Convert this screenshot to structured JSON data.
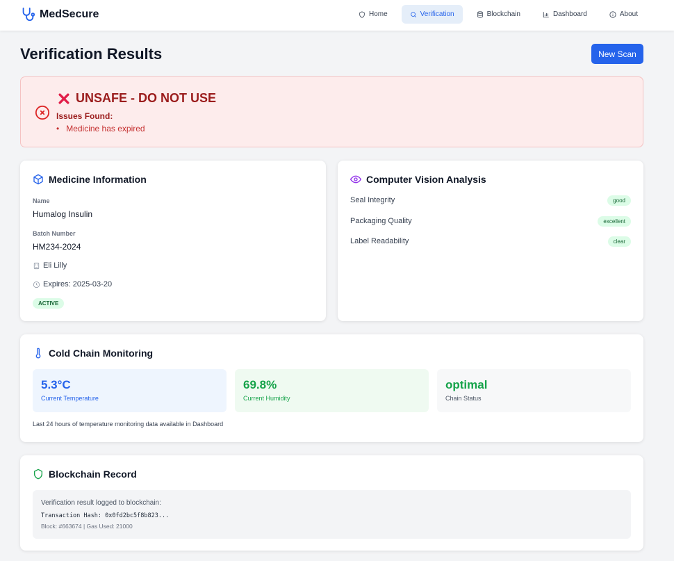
{
  "app": {
    "name": "MedSecure"
  },
  "nav": {
    "items": [
      {
        "label": "Home",
        "icon": "shield-icon",
        "active": false
      },
      {
        "label": "Verification",
        "icon": "search-icon",
        "active": true
      },
      {
        "label": "Blockchain",
        "icon": "database-icon",
        "active": false
      },
      {
        "label": "Dashboard",
        "icon": "bar-chart-icon",
        "active": false
      },
      {
        "label": "About",
        "icon": "info-icon",
        "active": false
      }
    ]
  },
  "page": {
    "title": "Verification Results",
    "new_scan_label": "New Scan"
  },
  "alert": {
    "title": "UNSAFE - DO NOT USE",
    "issues_label": "Issues Found:",
    "issues": [
      "Medicine has expired"
    ]
  },
  "medicine": {
    "title": "Medicine Information",
    "name_label": "Name",
    "name": "Humalog Insulin",
    "batch_label": "Batch Number",
    "batch": "HM234-2024",
    "manufacturer": "Eli Lilly",
    "expires": "Expires: 2025-03-20",
    "status": "ACTIVE"
  },
  "vision": {
    "title": "Computer Vision Analysis",
    "rows": [
      {
        "label": "Seal Integrity",
        "value": "good"
      },
      {
        "label": "Packaging Quality",
        "value": "excellent"
      },
      {
        "label": "Label Readability",
        "value": "clear"
      }
    ]
  },
  "cold_chain": {
    "title": "Cold Chain Monitoring",
    "temperature": {
      "value": "5.3°C",
      "label": "Current Temperature"
    },
    "humidity": {
      "value": "69.8%",
      "label": "Current Humidity"
    },
    "status": {
      "value": "optimal",
      "label": "Chain Status"
    },
    "note": "Last 24 hours of temperature monitoring data available in Dashboard"
  },
  "blockchain": {
    "title": "Blockchain Record",
    "line1": "Verification result logged to blockchain:",
    "hash": "Transaction Hash: 0x0fd2bc5f8b823...",
    "block": "Block: #663674 | Gas Used: 21000"
  },
  "colors": {
    "primary": "#2563eb",
    "danger": "#9b1c1c",
    "success": "#16a34a",
    "vision_accent": "#9333ea"
  }
}
